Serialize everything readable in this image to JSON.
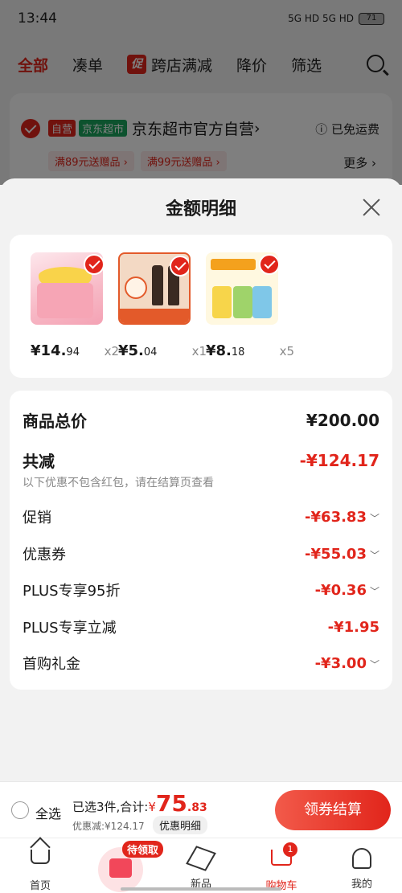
{
  "status_bar": {
    "time": "13:44",
    "signal": "5G HD 5G HD",
    "battery": "71"
  },
  "top_nav": {
    "tabs": [
      "全部",
      "凑单",
      "跨店满减",
      "降价",
      "筛选"
    ],
    "promo_badge": "促"
  },
  "store": {
    "tag_self": "自营",
    "tag_market": "京东超市",
    "name": "京东超市官方自营",
    "name_chevron": "›",
    "free_shipping": "ⓘ 已免运费",
    "coupons": [
      "满89元送赠品 ›",
      "满99元送赠品 ›"
    ],
    "more": "更多 ›"
  },
  "sheet": {
    "title": "金额明细",
    "products": [
      {
        "price_int": "¥14.",
        "price_dec": "94",
        "qty": "x2"
      },
      {
        "price_int": "¥5.",
        "price_dec": "04",
        "qty": "x1"
      },
      {
        "price_int": "¥8.",
        "price_dec": "18",
        "qty": "x5"
      }
    ],
    "total_label": "商品总价",
    "total_amount": "¥200.00",
    "reduce_label": "共减",
    "reduce_amount": "-¥124.17",
    "reduce_note": "以下优惠不包含红包，请在结算页查看",
    "lines": [
      {
        "label": "促销",
        "amount": "-¥63.83",
        "chevron": "﹀"
      },
      {
        "label": "优惠券",
        "amount": "-¥55.03",
        "chevron": "﹀"
      },
      {
        "label": "PLUS专享95折",
        "amount": "-¥0.36",
        "chevron": "﹀"
      },
      {
        "label": "PLUS专享立减",
        "amount": "-¥1.95",
        "chevron": ""
      },
      {
        "label": "首购礼金",
        "amount": "-¥3.00",
        "chevron": "﹀"
      }
    ]
  },
  "checkout": {
    "select_all": "全选",
    "summary_prefix": "已选3件,合计:",
    "yen": "¥",
    "price_int": "75",
    "price_dec": ".83",
    "saved": "优惠减:¥124.17",
    "detail_button": "优惠明细",
    "pay_button": "领券结算"
  },
  "bottom_nav": {
    "items": [
      "首页",
      "新品",
      "购物车",
      "我的"
    ],
    "gift_badge": "待领取",
    "cart_count": "1"
  },
  "colors": {
    "accent": "#e1251b",
    "market_green": "#1aa55d"
  }
}
